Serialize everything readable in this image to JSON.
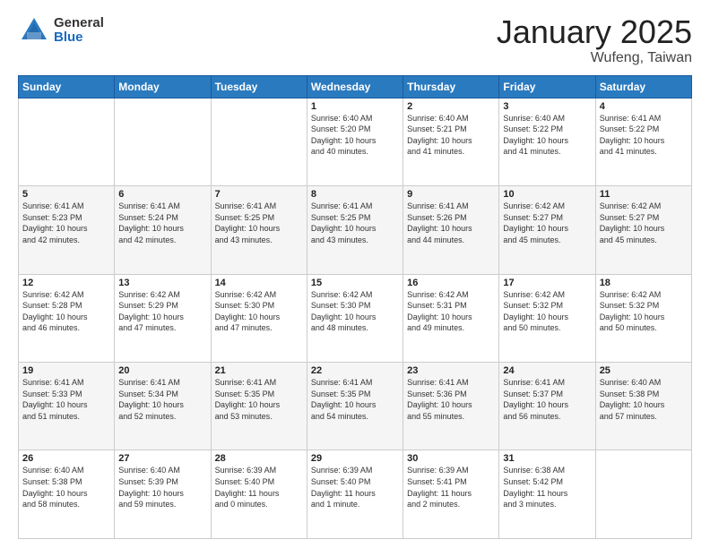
{
  "header": {
    "logo_general": "General",
    "logo_blue": "Blue",
    "month_title": "January 2025",
    "location": "Wufeng, Taiwan"
  },
  "days_of_week": [
    "Sunday",
    "Monday",
    "Tuesday",
    "Wednesday",
    "Thursday",
    "Friday",
    "Saturday"
  ],
  "weeks": [
    [
      {
        "day": "",
        "info": ""
      },
      {
        "day": "",
        "info": ""
      },
      {
        "day": "",
        "info": ""
      },
      {
        "day": "1",
        "info": "Sunrise: 6:40 AM\nSunset: 5:20 PM\nDaylight: 10 hours\nand 40 minutes."
      },
      {
        "day": "2",
        "info": "Sunrise: 6:40 AM\nSunset: 5:21 PM\nDaylight: 10 hours\nand 41 minutes."
      },
      {
        "day": "3",
        "info": "Sunrise: 6:40 AM\nSunset: 5:22 PM\nDaylight: 10 hours\nand 41 minutes."
      },
      {
        "day": "4",
        "info": "Sunrise: 6:41 AM\nSunset: 5:22 PM\nDaylight: 10 hours\nand 41 minutes."
      }
    ],
    [
      {
        "day": "5",
        "info": "Sunrise: 6:41 AM\nSunset: 5:23 PM\nDaylight: 10 hours\nand 42 minutes."
      },
      {
        "day": "6",
        "info": "Sunrise: 6:41 AM\nSunset: 5:24 PM\nDaylight: 10 hours\nand 42 minutes."
      },
      {
        "day": "7",
        "info": "Sunrise: 6:41 AM\nSunset: 5:25 PM\nDaylight: 10 hours\nand 43 minutes."
      },
      {
        "day": "8",
        "info": "Sunrise: 6:41 AM\nSunset: 5:25 PM\nDaylight: 10 hours\nand 43 minutes."
      },
      {
        "day": "9",
        "info": "Sunrise: 6:41 AM\nSunset: 5:26 PM\nDaylight: 10 hours\nand 44 minutes."
      },
      {
        "day": "10",
        "info": "Sunrise: 6:42 AM\nSunset: 5:27 PM\nDaylight: 10 hours\nand 45 minutes."
      },
      {
        "day": "11",
        "info": "Sunrise: 6:42 AM\nSunset: 5:27 PM\nDaylight: 10 hours\nand 45 minutes."
      }
    ],
    [
      {
        "day": "12",
        "info": "Sunrise: 6:42 AM\nSunset: 5:28 PM\nDaylight: 10 hours\nand 46 minutes."
      },
      {
        "day": "13",
        "info": "Sunrise: 6:42 AM\nSunset: 5:29 PM\nDaylight: 10 hours\nand 47 minutes."
      },
      {
        "day": "14",
        "info": "Sunrise: 6:42 AM\nSunset: 5:30 PM\nDaylight: 10 hours\nand 47 minutes."
      },
      {
        "day": "15",
        "info": "Sunrise: 6:42 AM\nSunset: 5:30 PM\nDaylight: 10 hours\nand 48 minutes."
      },
      {
        "day": "16",
        "info": "Sunrise: 6:42 AM\nSunset: 5:31 PM\nDaylight: 10 hours\nand 49 minutes."
      },
      {
        "day": "17",
        "info": "Sunrise: 6:42 AM\nSunset: 5:32 PM\nDaylight: 10 hours\nand 50 minutes."
      },
      {
        "day": "18",
        "info": "Sunrise: 6:42 AM\nSunset: 5:32 PM\nDaylight: 10 hours\nand 50 minutes."
      }
    ],
    [
      {
        "day": "19",
        "info": "Sunrise: 6:41 AM\nSunset: 5:33 PM\nDaylight: 10 hours\nand 51 minutes."
      },
      {
        "day": "20",
        "info": "Sunrise: 6:41 AM\nSunset: 5:34 PM\nDaylight: 10 hours\nand 52 minutes."
      },
      {
        "day": "21",
        "info": "Sunrise: 6:41 AM\nSunset: 5:35 PM\nDaylight: 10 hours\nand 53 minutes."
      },
      {
        "day": "22",
        "info": "Sunrise: 6:41 AM\nSunset: 5:35 PM\nDaylight: 10 hours\nand 54 minutes."
      },
      {
        "day": "23",
        "info": "Sunrise: 6:41 AM\nSunset: 5:36 PM\nDaylight: 10 hours\nand 55 minutes."
      },
      {
        "day": "24",
        "info": "Sunrise: 6:41 AM\nSunset: 5:37 PM\nDaylight: 10 hours\nand 56 minutes."
      },
      {
        "day": "25",
        "info": "Sunrise: 6:40 AM\nSunset: 5:38 PM\nDaylight: 10 hours\nand 57 minutes."
      }
    ],
    [
      {
        "day": "26",
        "info": "Sunrise: 6:40 AM\nSunset: 5:38 PM\nDaylight: 10 hours\nand 58 minutes."
      },
      {
        "day": "27",
        "info": "Sunrise: 6:40 AM\nSunset: 5:39 PM\nDaylight: 10 hours\nand 59 minutes."
      },
      {
        "day": "28",
        "info": "Sunrise: 6:39 AM\nSunset: 5:40 PM\nDaylight: 11 hours\nand 0 minutes."
      },
      {
        "day": "29",
        "info": "Sunrise: 6:39 AM\nSunset: 5:40 PM\nDaylight: 11 hours\nand 1 minute."
      },
      {
        "day": "30",
        "info": "Sunrise: 6:39 AM\nSunset: 5:41 PM\nDaylight: 11 hours\nand 2 minutes."
      },
      {
        "day": "31",
        "info": "Sunrise: 6:38 AM\nSunset: 5:42 PM\nDaylight: 11 hours\nand 3 minutes."
      },
      {
        "day": "",
        "info": ""
      }
    ]
  ]
}
